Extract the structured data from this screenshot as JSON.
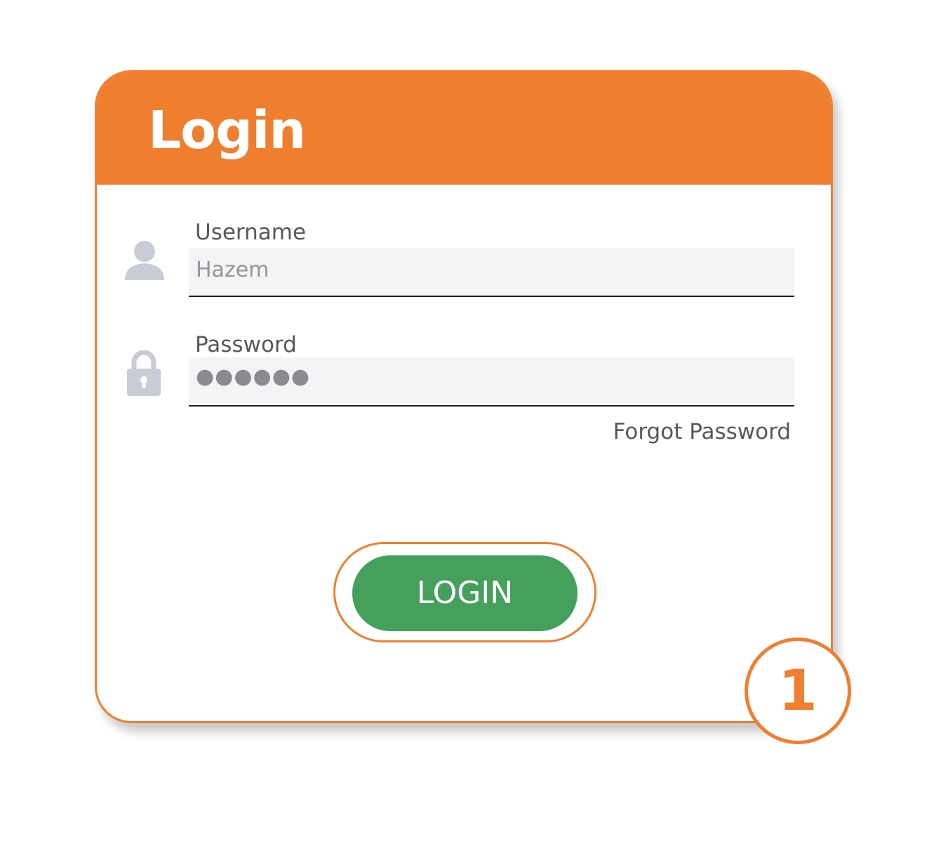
{
  "card": {
    "title": "Login"
  },
  "username": {
    "label": "Username",
    "value": "Hazem",
    "icon": "user-icon"
  },
  "password": {
    "label": "Password",
    "masked_value": "●●●●●●",
    "icon": "lock-icon"
  },
  "links": {
    "forgot_password": "Forgot Password"
  },
  "actions": {
    "login_label": "LOGIN"
  },
  "step_badge": {
    "number": "1"
  },
  "colors": {
    "accent": "#f07e2f",
    "button": "#45a05c",
    "icon": "#c9ccd6",
    "field_bg": "#f3f4f6"
  }
}
